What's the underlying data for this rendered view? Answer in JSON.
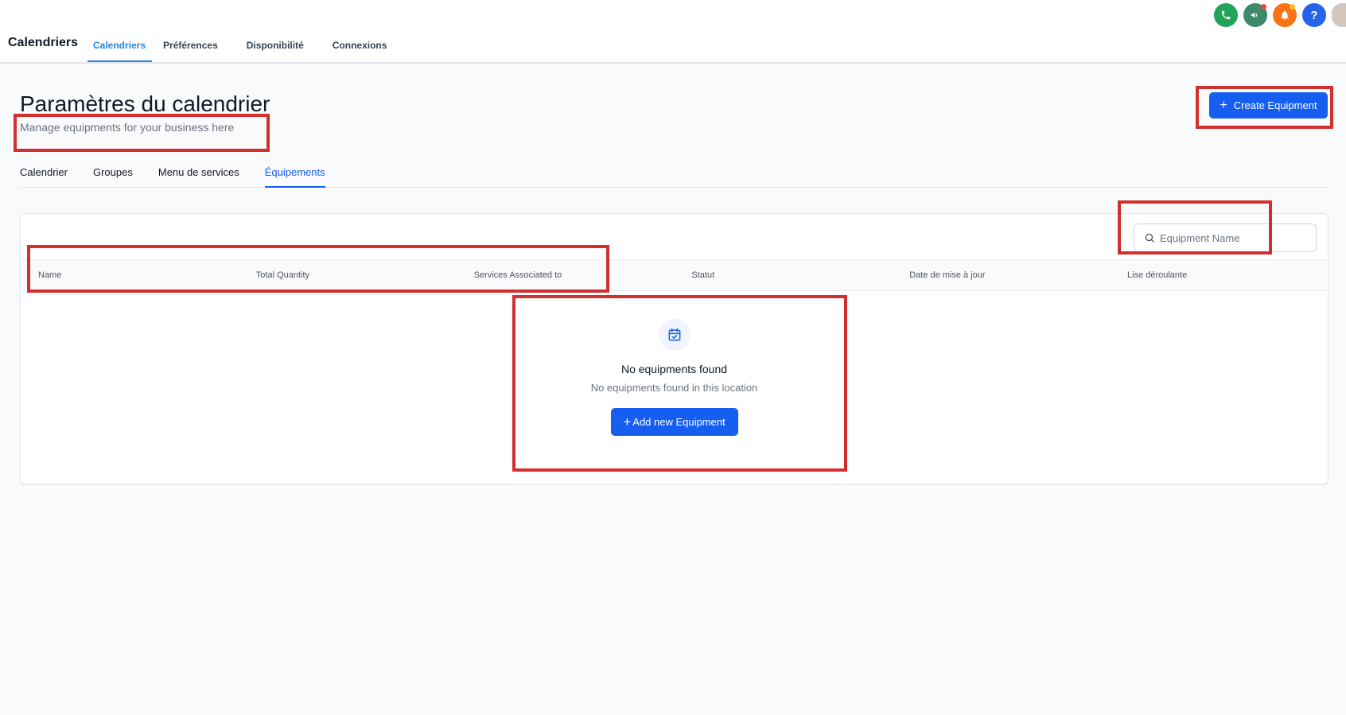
{
  "app": {
    "title": "Calendriers"
  },
  "top_tabs": [
    {
      "label": "Calendriers",
      "active": true
    },
    {
      "label": "Préférences",
      "active": false
    },
    {
      "label": "Disponibilité",
      "active": false
    },
    {
      "label": "Connexions",
      "active": false
    }
  ],
  "top_icons": [
    {
      "name": "phone-icon",
      "glyph": "✆",
      "color": "#22a35a"
    },
    {
      "name": "megaphone-icon",
      "glyph": "📢",
      "color": "#3d8a6b"
    },
    {
      "name": "bell-icon",
      "glyph": "🔔",
      "color": "#f97316"
    },
    {
      "name": "help-icon",
      "glyph": "?",
      "color": "#2563eb"
    }
  ],
  "header": {
    "title": "Paramètres du calendrier",
    "subtitle": "Manage equipments for your business here",
    "create_button": "Create Equipment"
  },
  "sub_tabs": [
    {
      "label": "Calendrier",
      "active": false
    },
    {
      "label": "Groupes",
      "active": false
    },
    {
      "label": "Menu de services",
      "active": false
    },
    {
      "label": "Équipements",
      "active": true
    }
  ],
  "search": {
    "placeholder": "Equipment Name",
    "value": ""
  },
  "table": {
    "columns": [
      "Name",
      "Total Quantity",
      "Services Associated to",
      "Statut",
      "Date de mise à jour",
      "Lise déroulante"
    ],
    "rows": []
  },
  "empty_state": {
    "title": "No equipments found",
    "subtitle": "No equipments found in this location",
    "button": "Add new Equipment"
  },
  "colors": {
    "primary": "#155eef",
    "annotation": "#d32f2f"
  }
}
